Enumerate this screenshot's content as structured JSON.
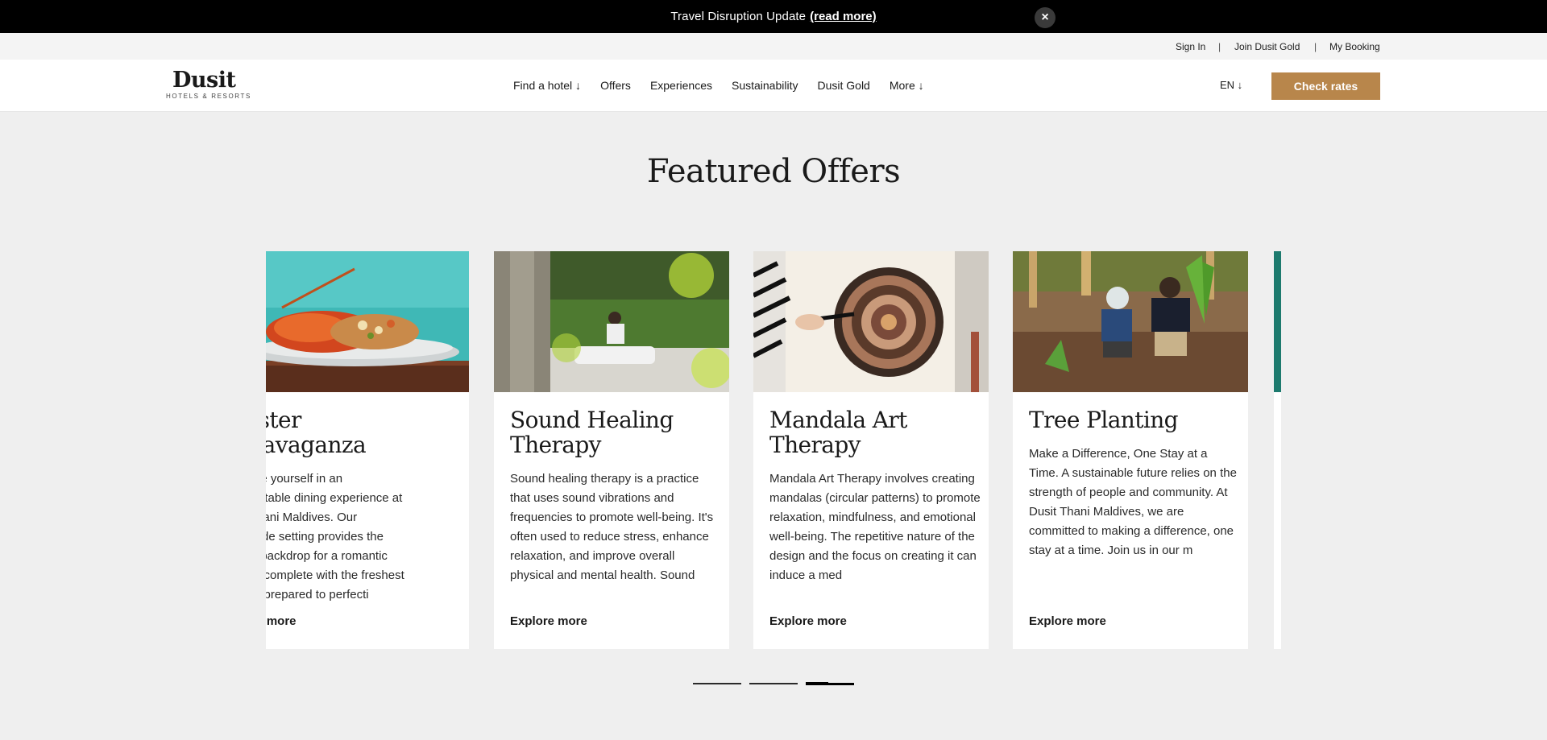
{
  "alert": {
    "text": "Travel Disruption Update",
    "link": "(read more)",
    "close": "×"
  },
  "utility": {
    "sign_in": "Sign In",
    "separator": "|",
    "join": "Join Dusit Gold",
    "booking": "My Booking"
  },
  "nav": {
    "logo": "Dusit",
    "logo_sub": "HOTELS & RESORTS",
    "items": [
      "Find a hotel ↓",
      "Offers",
      "Experiences",
      "Sustainability",
      "Dusit Gold",
      "More ↓"
    ],
    "language": "EN ↓",
    "cta": "Check rates"
  },
  "section": {
    "title": "Featured Offers"
  },
  "cards": [
    {
      "title": "obster\nxtravaganza",
      "description": "merse yourself in an\nforgettable dining experience at\nsit Thani Maldives. Our\nachside setting provides the\nrfect backdrop for a romantic\nnner, complete with the freshest\noster prepared to perfecti",
      "link": "plore more"
    },
    {
      "title": "Sound Healing\nTherapy",
      "description": "Sound healing therapy is a practice that uses sound vibrations and frequencies to promote well-being. It's often used to reduce stress, enhance relaxation, and improve overall physical and mental health. Sound",
      "link": "Explore more"
    },
    {
      "title": "Mandala Art\nTherapy",
      "description": "Mandala Art Therapy involves creating mandalas (circular patterns) to promote relaxation, mindfulness, and emotional well-being. The repetitive nature of the design and the focus on creating it can induce a med",
      "link": "Explore more"
    },
    {
      "title": "Tree Planting",
      "description": "Make a Difference, One Stay at a Time. A sustainable future relies on the strength of people and community. At Dusit Thani Maldives, we are committed to making a difference, one stay at a time. Join us in our m",
      "link": "Explore more"
    }
  ],
  "pager": {
    "count": 3,
    "active": 3
  },
  "colors": {
    "accent": "#b8864b",
    "alert_bg": "#000000",
    "page_bg": "#efefef"
  }
}
